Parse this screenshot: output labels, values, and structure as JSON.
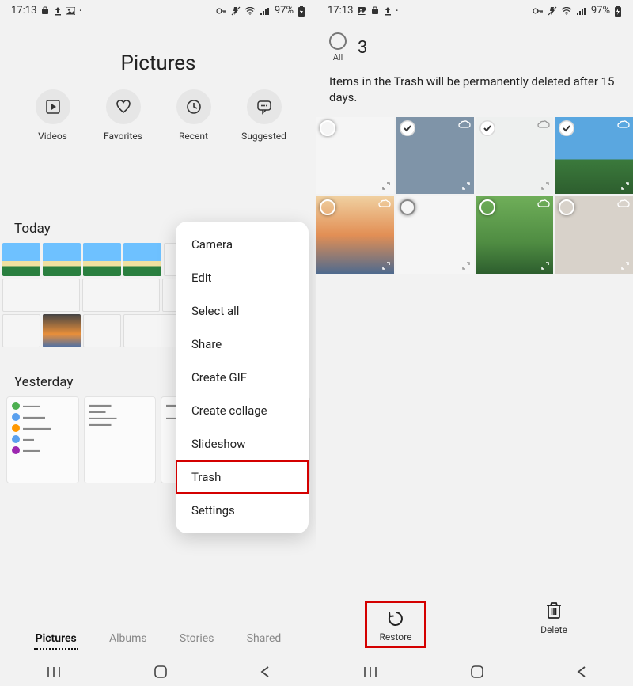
{
  "status": {
    "time": "17:13",
    "battery": "97%"
  },
  "left_screen": {
    "title": "Pictures",
    "categories": [
      {
        "label": "Videos",
        "icon": "play-icon"
      },
      {
        "label": "Favorites",
        "icon": "heart-icon"
      },
      {
        "label": "Recent",
        "icon": "clock-icon"
      },
      {
        "label": "Suggested",
        "icon": "speech-icon"
      }
    ],
    "sections": {
      "today": "Today",
      "yesterday": "Yesterday"
    },
    "tabs": {
      "pictures": "Pictures",
      "albums": "Albums",
      "stories": "Stories",
      "shared": "Shared"
    },
    "popup_menu": [
      "Camera",
      "Edit",
      "Select all",
      "Share",
      "Create GIF",
      "Create collage",
      "Slideshow",
      "Trash",
      "Settings"
    ]
  },
  "right_screen": {
    "select_all_label": "All",
    "selected_count": "3",
    "trash_note": "Items in the Trash will be permanently deleted after 15 days.",
    "actions": {
      "restore": "Restore",
      "delete": "Delete"
    }
  }
}
